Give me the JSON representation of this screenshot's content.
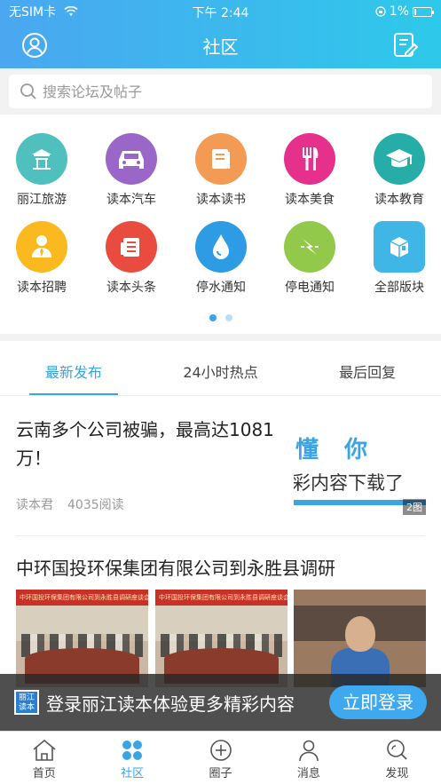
{
  "status_bar": {
    "carrier": "无SIM卡",
    "time": "下午 2:44",
    "battery": "1%"
  },
  "header": {
    "title": "社区"
  },
  "search": {
    "placeholder": "搜索论坛及帖子"
  },
  "categories": [
    {
      "label": "丽江旅游",
      "icon": "pavilion-icon",
      "color": "#4fc0bd"
    },
    {
      "label": "读本汽车",
      "icon": "car-icon",
      "color": "#9a67c9"
    },
    {
      "label": "读本读书",
      "icon": "book-icon",
      "color": "#f39a55"
    },
    {
      "label": "读本美食",
      "icon": "fork-knife-icon",
      "color": "#e6318c"
    },
    {
      "label": "读本教育",
      "icon": "graduation-cap-icon",
      "color": "#26ada8"
    },
    {
      "label": "读本招聘",
      "icon": "person-icon",
      "color": "#f9b91f"
    },
    {
      "label": "读本头条",
      "icon": "news-icon",
      "color": "#e94c3e"
    },
    {
      "label": "停水通知",
      "icon": "water-drop-icon",
      "color": "#2e9be5"
    },
    {
      "label": "停电通知",
      "icon": "lightning-icon",
      "color": "#93c94a"
    },
    {
      "label": "全部版块",
      "icon": "box-icon",
      "color": "#3fb6e6"
    }
  ],
  "tabs": [
    "最新发布",
    "24小时热点",
    "最后回复"
  ],
  "posts": [
    {
      "title": "云南多个公司被骗，最高达1081万！",
      "author": "读本君",
      "reads": "4035阅读",
      "thumb_text_1": "懂 你",
      "thumb_text_2": "彩内容下载了",
      "image_count": "2图"
    },
    {
      "title": "中环国投环保集团有限公司到永胜县调研",
      "photo_banner": "中环国投环保集团有限公司到永胜县调研座谈会"
    }
  ],
  "login_banner": {
    "logo_text": "丽江读本",
    "text": "登录丽江读本体验更多精彩内容",
    "button": "立即登录"
  },
  "tabbar": [
    {
      "label": "首页",
      "icon": "home-icon"
    },
    {
      "label": "社区",
      "icon": "community-icon"
    },
    {
      "label": "圈子",
      "icon": "plus-circle-icon"
    },
    {
      "label": "消息",
      "icon": "person-icon"
    },
    {
      "label": "发现",
      "icon": "discover-icon"
    }
  ]
}
